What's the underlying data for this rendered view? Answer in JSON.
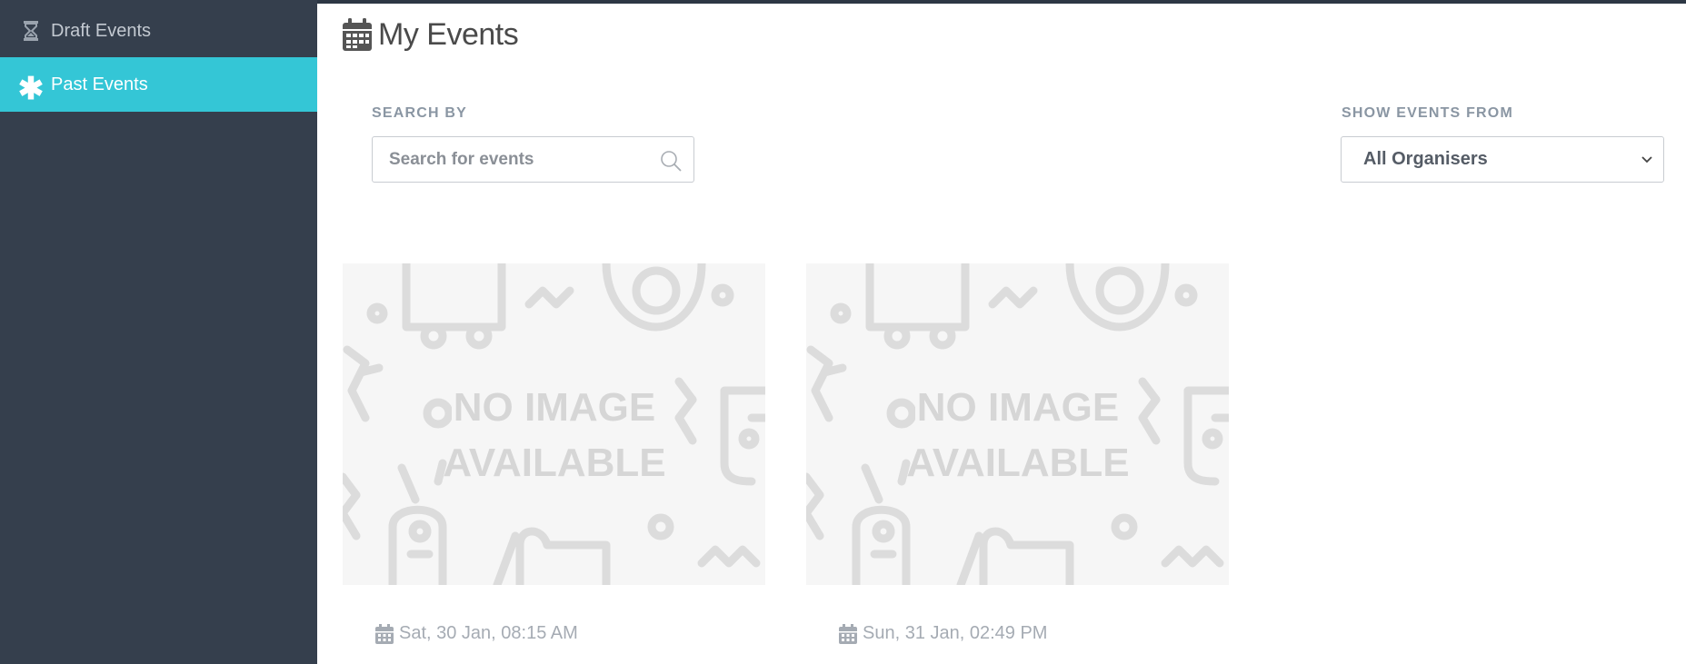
{
  "sidebar": {
    "items": [
      {
        "label": "Draft Events",
        "icon": "hourglass-icon",
        "active": false
      },
      {
        "label": "Past Events",
        "icon": "asterisk-icon",
        "active": true
      }
    ]
  },
  "header": {
    "title": "My Events",
    "icon": "calendar-icon"
  },
  "filters": {
    "search_label": "SEARCH BY",
    "search_placeholder": "Search for events",
    "search_value": "",
    "show_label": "SHOW EVENTS FROM",
    "organiser_selected": "All Organisers"
  },
  "events": [
    {
      "image_text_line1": "NO IMAGE",
      "image_text_line2": "AVAILABLE",
      "date": "Sat, 30 Jan, 08:15 AM"
    },
    {
      "image_text_line1": "NO IMAGE",
      "image_text_line2": "AVAILABLE",
      "date": "Sun, 31 Jan, 02:49 PM"
    }
  ],
  "colors": {
    "sidebar_bg": "#353f4d",
    "active_item": "#34c6d6",
    "label_text": "#8a96a3",
    "placeholder_bg": "#f6f6f6",
    "placeholder_art": "#dcdcdc"
  }
}
